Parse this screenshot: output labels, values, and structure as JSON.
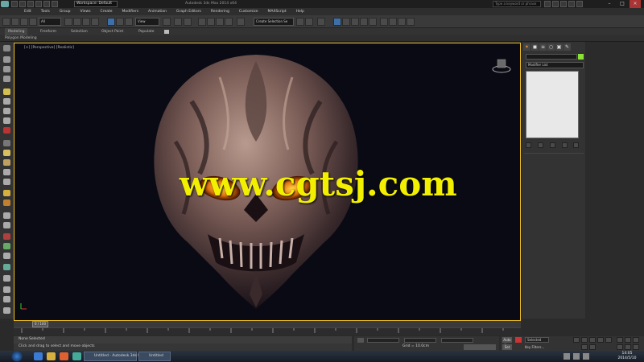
{
  "titlebar": {
    "workspace": "Workspace: Default",
    "title": "Autodesk 3ds Max 2014 x64",
    "search_placeholder": "Type a keyword or phrase"
  },
  "menu": [
    "Edit",
    "Tools",
    "Group",
    "Views",
    "Create",
    "Modifiers",
    "Animation",
    "Graph Editors",
    "Rendering",
    "Customize",
    "MAXScript",
    "Help"
  ],
  "toolbar": {
    "filter": "All",
    "view_dropdown": "View",
    "selection_set": "Create Selection Se"
  },
  "ribbon": {
    "tabs": [
      "Modeling",
      "Freeform",
      "Selection",
      "Object Paint",
      "Populate"
    ],
    "sub": "Polygon Modeling"
  },
  "viewport": {
    "label": "[+] [Perspective] [Realistic]",
    "watermark": "www.cgtsj.com"
  },
  "command_panel": {
    "modifier_list": "Modifier List"
  },
  "timeline": {
    "frame": "0 / 100"
  },
  "status": {
    "line1": "None Selected",
    "line2": "Click and drag to select and move objects"
  },
  "coords": {
    "grid": "Grid = 10.0cm",
    "autokey": "Auto Key",
    "setkey": "Set Key",
    "selected": "Selected",
    "keyfilters": "Key Filters..."
  },
  "taskbar": {
    "windows": [
      "Untitled - Autodesk 3ds Max...",
      "Untitled"
    ],
    "clock_time": "14:05",
    "clock_date": "2014/5/10"
  }
}
